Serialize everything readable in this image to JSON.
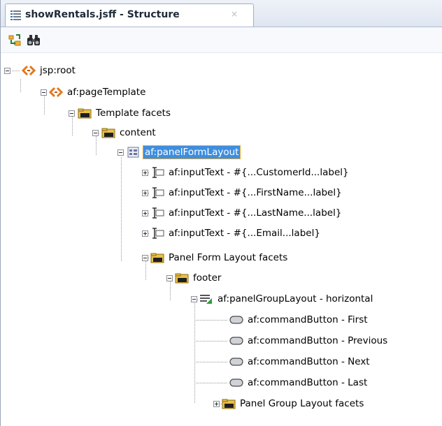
{
  "tab": {
    "title": "showRentals.jsff - Structure",
    "close": "×"
  },
  "toolbar": {
    "buttons": [
      {
        "icon": "synchronize-icon"
      },
      {
        "icon": "find-binoculars-icon"
      }
    ]
  },
  "tree": {
    "nodes": [
      {
        "label": "jsp:root",
        "icon": "xml-tag-icon"
      },
      {
        "label": "af:pageTemplate",
        "icon": "xml-tag-icon"
      },
      {
        "label": "Template facets",
        "icon": "folder-icon"
      },
      {
        "label": "content",
        "icon": "folder-icon"
      },
      {
        "label": "af:panelFormLayout",
        "icon": "panel-form-layout-icon",
        "selected": true
      },
      {
        "label": "af:inputText - #{...CustomerId...label}",
        "icon": "input-text-icon"
      },
      {
        "label": "af:inputText - #{...FirstName...label}",
        "icon": "input-text-icon"
      },
      {
        "label": "af:inputText - #{...LastName...label}",
        "icon": "input-text-icon"
      },
      {
        "label": "af:inputText - #{...Email...label}",
        "icon": "input-text-icon"
      },
      {
        "label": "Panel Form Layout facets",
        "icon": "folder-icon"
      },
      {
        "label": "footer",
        "icon": "folder-icon"
      },
      {
        "label": "af:panelGroupLayout - horizontal",
        "icon": "panel-group-layout-icon"
      },
      {
        "label": "af:commandButton - First",
        "icon": "command-button-icon"
      },
      {
        "label": "af:commandButton - Previous",
        "icon": "command-button-icon"
      },
      {
        "label": "af:commandButton - Next",
        "icon": "command-button-icon"
      },
      {
        "label": "af:commandButton - Last",
        "icon": "command-button-icon"
      },
      {
        "label": "Panel Group Layout facets",
        "icon": "folder-icon"
      }
    ]
  }
}
